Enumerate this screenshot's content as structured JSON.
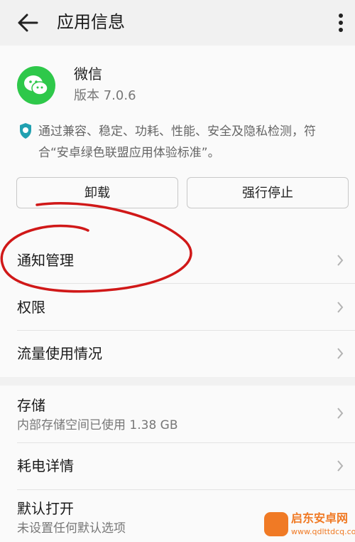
{
  "header": {
    "title": "应用信息",
    "back_icon": "back-arrow-icon",
    "more_icon": "more-vertical-icon"
  },
  "app": {
    "name": "微信",
    "version": "版本 7.0.6",
    "icon": "wechat-icon",
    "icon_color": "#2ec84a"
  },
  "certification": {
    "icon": "shield-check-icon",
    "text": "通过兼容、稳定、功耗、性能、安全及隐私检测，符合“安卓绿色联盟应用体验标准”。"
  },
  "buttons": {
    "uninstall": "卸载",
    "force_stop": "强行停止"
  },
  "settings": [
    {
      "label": "通知管理"
    },
    {
      "label": "权限"
    },
    {
      "label": "流量使用情况"
    }
  ],
  "storage": [
    {
      "label": "存储",
      "sub": "内部存储空间已使用 1.38 GB"
    },
    {
      "label": "耗电详情"
    },
    {
      "label": "默认打开",
      "sub": "未设置任何默认选项"
    }
  ],
  "annotation": {
    "color": "#d01818"
  },
  "watermark": {
    "title": "启东安卓网",
    "url": "www.qdlttdcq.com",
    "color": "#f07a25"
  }
}
